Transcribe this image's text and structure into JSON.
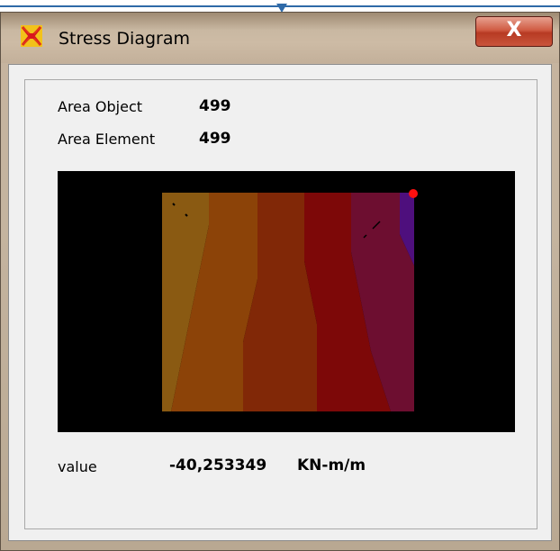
{
  "window": {
    "title": "Stress Diagram",
    "close_label": "X",
    "icon": "app-icon"
  },
  "fields": {
    "area_object_label": "Area Object",
    "area_object_value": "499",
    "area_element_label": "Area Element",
    "area_element_value": "499",
    "value_label": "value",
    "value_number": "-40,253349",
    "value_unit": "KN-m/m"
  },
  "colors": {
    "band_1": "#8a5a12",
    "band_2": "#8c4308",
    "band_3": "#812807",
    "band_4": "#7d0808",
    "band_5": "#6d0e30",
    "band_6": "#4e0f7d",
    "marker": "#ff1010",
    "plot_background": "#000000"
  }
}
